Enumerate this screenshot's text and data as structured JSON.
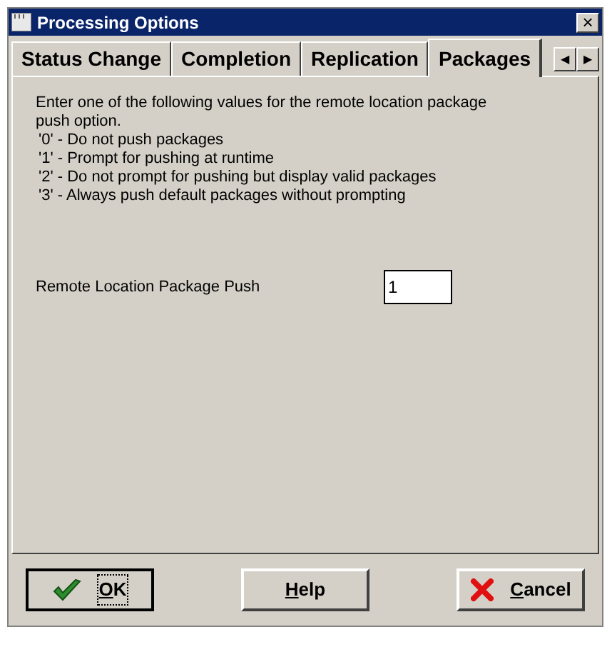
{
  "window": {
    "title": "Processing Options",
    "close": "×"
  },
  "tabs": [
    {
      "label": "Status Change",
      "selected": false
    },
    {
      "label": "Completion",
      "selected": false
    },
    {
      "label": "Replication",
      "selected": false
    },
    {
      "label": "Packages",
      "selected": true
    }
  ],
  "tab_scroll": [
    "◀",
    "▶"
  ],
  "description": "Enter one of the following values for the remote location package push option.",
  "options": [
    "'0' - Do not push packages",
    "'1' - Prompt for pushing at runtime",
    "'2' - Do not prompt for pushing but display valid packages",
    "'3' - Always push default packages without prompting"
  ],
  "field": {
    "label": "Remote Location Package Push",
    "value": "1"
  },
  "buttons": [
    {
      "kind": "ok",
      "label": "OK",
      "focused": true
    },
    {
      "kind": "help",
      "label": "Help",
      "focused": false
    },
    {
      "kind": "cancel",
      "label": "Cancel",
      "focused": false
    }
  ]
}
